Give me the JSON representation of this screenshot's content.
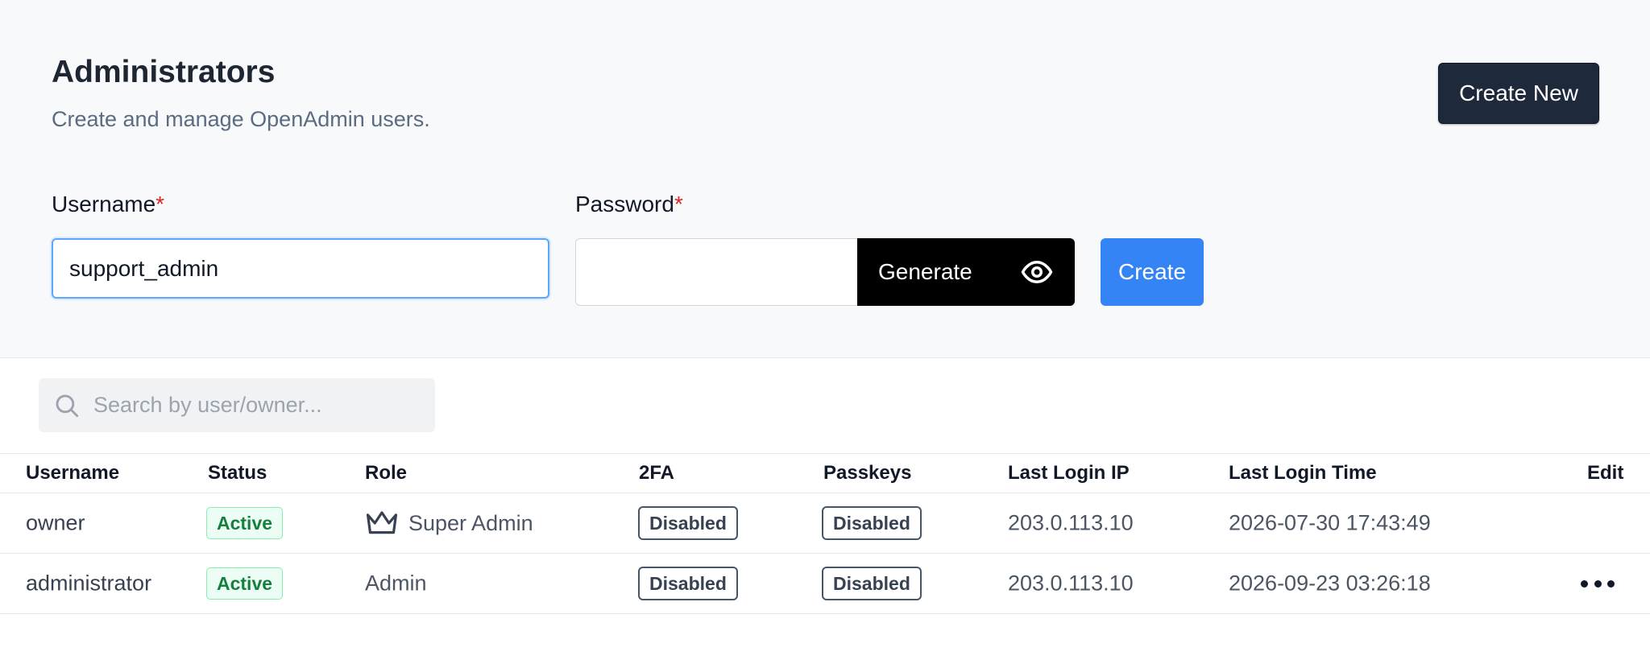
{
  "header": {
    "title": "Administrators",
    "subtitle": "Create and manage OpenAdmin users.",
    "create_new_label": "Create New"
  },
  "form": {
    "username_label": "Username",
    "password_label": "Password",
    "required_mark": "*",
    "username_value": "support_admin",
    "password_value": "",
    "generate_label": "Generate",
    "create_label": "Create"
  },
  "search": {
    "placeholder": "Search by user/owner..."
  },
  "table": {
    "columns": [
      "Username",
      "Status",
      "Role",
      "2FA",
      "Passkeys",
      "Last Login IP",
      "Last Login Time",
      "Edit"
    ],
    "rows": [
      {
        "username": "owner",
        "status": "Active",
        "role": "Super Admin",
        "role_icon": "crown-icon",
        "twofa": "Disabled",
        "passkeys": "Disabled",
        "last_login_ip": "203.0.113.10",
        "last_login_time": "2026-07-30 17:43:49",
        "edit": ""
      },
      {
        "username": "administrator",
        "status": "Active",
        "role": "Admin",
        "twofa": "Disabled",
        "passkeys": "Disabled",
        "last_login_ip": "203.0.113.10",
        "last_login_time": "2026-09-23 03:26:18",
        "edit": "more-options-icon"
      }
    ]
  },
  "colors": {
    "primary_blue": "#3584f6",
    "dark_button": "#1e293b",
    "active_green": "#15803d",
    "required_red": "#dc2626"
  }
}
